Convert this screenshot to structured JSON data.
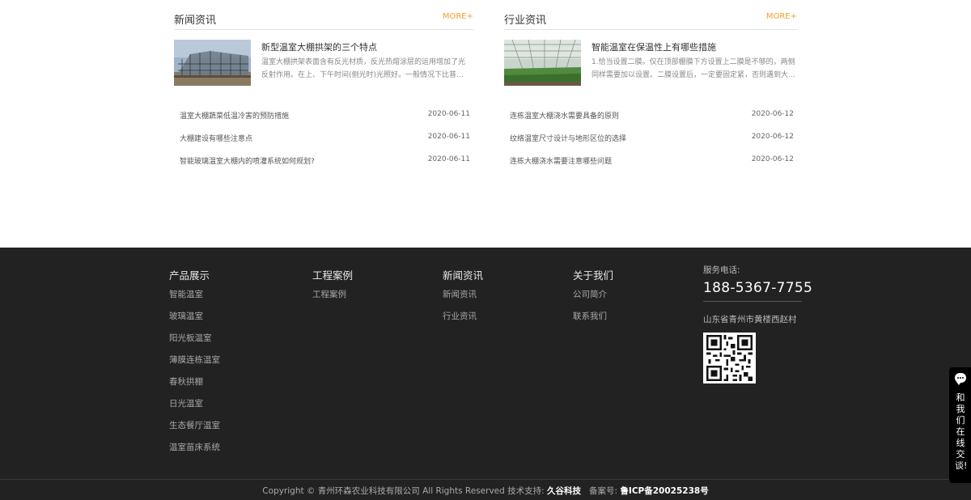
{
  "news": {
    "title": "新闻资讯",
    "more": "MORE+",
    "feature": {
      "title": "新型温室大棚拱架的三个特点",
      "desc": "温室大棚拱架表面含有反光材质，反光热熔涂层的运用增加了光反射作用。在上、下午时间(侧光时)光照好。一般情况下比普..."
    },
    "items": [
      {
        "title": "温室大棚蔬菜低温冷害的预防措施",
        "date": "2020-06-11"
      },
      {
        "title": "大棚建设有哪些注意点",
        "date": "2020-06-11"
      },
      {
        "title": "智能玻璃温室大棚内的喷灌系统如何规划?",
        "date": "2020-06-11"
      }
    ]
  },
  "industry": {
    "title": "行业资讯",
    "more": "MORE+",
    "feature": {
      "title": "智能温室在保温性上有哪些措施",
      "desc": "1.恰当设置二膜。仅在顶部棚膜下方设置上二膜是不够的，两侧同样需要加以设置。二膜设置后，一定要固定紧，否则遇到大..."
    },
    "items": [
      {
        "title": "连栋温室大棚浇水需要具备的原则",
        "date": "2020-06-12"
      },
      {
        "title": "纹络温室尺寸设计与地形区位的选择",
        "date": "2020-06-12"
      },
      {
        "title": "连栋大棚浇水需要注意哪些问题",
        "date": "2020-06-12"
      }
    ]
  },
  "footer": {
    "columns": [
      {
        "title": "产品展示",
        "items": [
          "智能温室",
          "玻璃温室",
          "阳光板温室",
          "薄膜连栋温室",
          "春秋拱棚",
          "日光温室",
          "生态餐厅温室",
          "温室苗床系统"
        ]
      },
      {
        "title": "工程案例",
        "items": [
          "工程案例"
        ]
      },
      {
        "title": "新闻资讯",
        "items": [
          "新闻资讯",
          "行业资讯"
        ]
      },
      {
        "title": "关于我们",
        "items": [
          "公司简介",
          "联系我们"
        ]
      }
    ],
    "phone_label": "服务电话:",
    "phone": "188-5367-7755",
    "address": "山东省青州市黄楼西赵村",
    "copyright_prefix": "Copyright © 青州环森农业科技有限公司 All Rights Reserved 技术支持:",
    "support": "久谷科技",
    "icp_label": "备案号:",
    "icp": "鲁ICP备20025238号"
  },
  "chat": {
    "label": "和我们在线交谈!"
  },
  "colors": {
    "accent": "#f0a030",
    "footer_bg": "#232222"
  }
}
